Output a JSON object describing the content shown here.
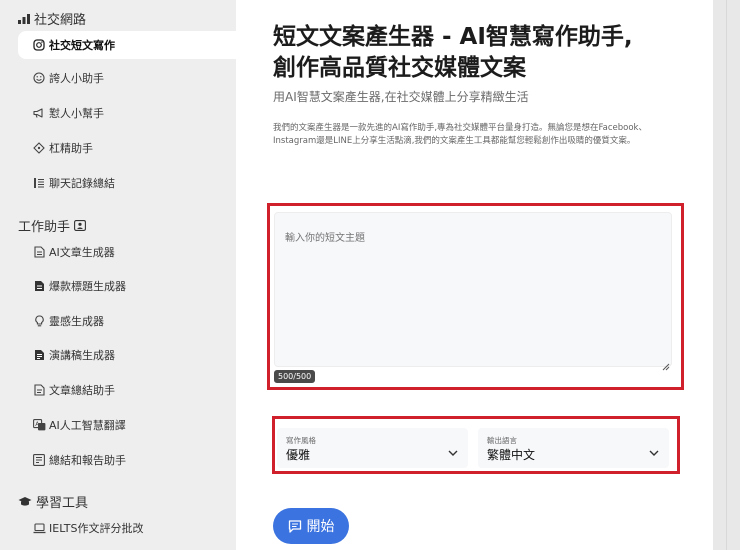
{
  "sidebar": {
    "social_section": "社交網路",
    "work_section": "工作助手",
    "study_section": "學習工具",
    "items": [
      {
        "label": "社交短文寫作"
      },
      {
        "label": "誇人小助手"
      },
      {
        "label": "懟人小幫手"
      },
      {
        "label": "杠精助手"
      },
      {
        "label": "聊天記錄總結"
      },
      {
        "label": "AI文章生成器"
      },
      {
        "label": "爆款標題生成器"
      },
      {
        "label": "靈感生成器"
      },
      {
        "label": "演講稿生成器"
      },
      {
        "label": "文章總結助手"
      },
      {
        "label": "AI人工智慧翻譯"
      },
      {
        "label": "總結和報告助手"
      },
      {
        "label": "IELTS作文評分批改"
      }
    ]
  },
  "main": {
    "title_line1": "短文文案產生器 - AI智慧寫作助手,",
    "title_line2": "創作高品質社交媒體文案",
    "subtitle": "用AI智慧文案產生器,在社交媒體上分享精緻生活",
    "description": "我們的文案產生器是一款先進的AI寫作助手,專為社交媒體平台量身打造。無論您是想在Facebook、Instagram還是LINE上分享生活點滴,我們的文案產生工具都能幫您輕鬆創作出吸睛的優質文案。",
    "input_placeholder": "輸入你的短文主題",
    "char_counter": "500/500",
    "style_label": "寫作風格",
    "style_value": "優雅",
    "lang_label": "輸出語言",
    "lang_value": "繁體中文",
    "start_label": "開始"
  },
  "colors": {
    "accent": "#3b73e0",
    "highlight_box": "#d0202c"
  }
}
